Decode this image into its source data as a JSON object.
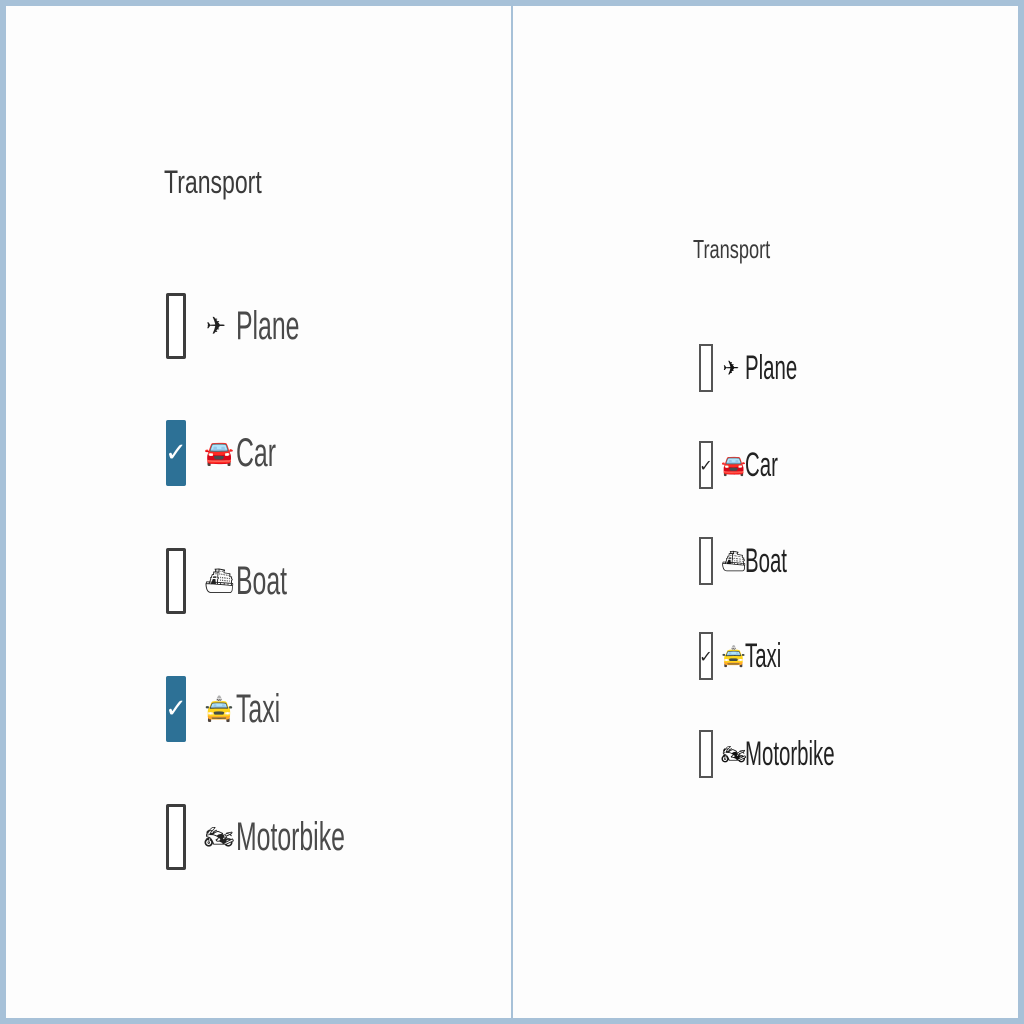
{
  "left": {
    "legend": "Transport",
    "options": [
      {
        "label": "Plane",
        "icon": "plane-icon",
        "glyph": "✈",
        "checked": false
      },
      {
        "label": "Car",
        "icon": "car-icon",
        "glyph": "🚘",
        "checked": true
      },
      {
        "label": "Boat",
        "icon": "boat-icon",
        "glyph": "⛴",
        "checked": false
      },
      {
        "label": "Taxi",
        "icon": "taxi-icon",
        "glyph": "🚖",
        "checked": true
      },
      {
        "label": "Motorbike",
        "icon": "motorbike-icon",
        "glyph": "🏍",
        "checked": false
      }
    ],
    "check_glyph": "✓",
    "accent_color": "#2d7196"
  },
  "right": {
    "legend": "Transport",
    "options": [
      {
        "label": "Plane",
        "icon": "plane-icon",
        "glyph": "✈",
        "checked": false
      },
      {
        "label": "Car",
        "icon": "car-icon",
        "glyph": "🚘",
        "checked": true
      },
      {
        "label": "Boat",
        "icon": "boat-icon",
        "glyph": "⛴",
        "checked": false
      },
      {
        "label": "Taxi",
        "icon": "taxi-icon",
        "glyph": "🚖",
        "checked": true
      },
      {
        "label": "Motorbike",
        "icon": "motorbike-icon",
        "glyph": "🏍",
        "checked": false
      }
    ],
    "check_glyph": "✓"
  }
}
